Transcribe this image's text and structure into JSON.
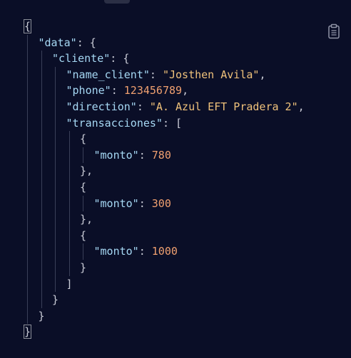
{
  "json_lines": [
    {
      "indent": 0,
      "parts": [
        {
          "t": "p",
          "v": "{"
        }
      ]
    },
    {
      "indent": 1,
      "parts": [
        {
          "t": "k",
          "v": "\"data\""
        },
        {
          "t": "p",
          "v": ": {"
        }
      ]
    },
    {
      "indent": 2,
      "parts": [
        {
          "t": "k",
          "v": "\"cliente\""
        },
        {
          "t": "p",
          "v": ": {"
        }
      ]
    },
    {
      "indent": 3,
      "parts": [
        {
          "t": "k",
          "v": "\"name_client\""
        },
        {
          "t": "p",
          "v": ": "
        },
        {
          "t": "s",
          "v": "\"Josthen Avila\""
        },
        {
          "t": "p",
          "v": ","
        }
      ]
    },
    {
      "indent": 3,
      "parts": [
        {
          "t": "k",
          "v": "\"phone\""
        },
        {
          "t": "p",
          "v": ": "
        },
        {
          "t": "n",
          "v": "123456789"
        },
        {
          "t": "p",
          "v": ","
        }
      ]
    },
    {
      "indent": 3,
      "parts": [
        {
          "t": "k",
          "v": "\"direction\""
        },
        {
          "t": "p",
          "v": ": "
        },
        {
          "t": "s",
          "v": "\"A. Azul EFT Pradera 2\""
        },
        {
          "t": "p",
          "v": ","
        }
      ]
    },
    {
      "indent": 3,
      "parts": [
        {
          "t": "k",
          "v": "\"transacciones\""
        },
        {
          "t": "p",
          "v": ": ["
        }
      ]
    },
    {
      "indent": 4,
      "parts": [
        {
          "t": "p",
          "v": "{"
        }
      ]
    },
    {
      "indent": 5,
      "parts": [
        {
          "t": "k",
          "v": "\"monto\""
        },
        {
          "t": "p",
          "v": ": "
        },
        {
          "t": "n",
          "v": "780"
        }
      ]
    },
    {
      "indent": 4,
      "parts": [
        {
          "t": "p",
          "v": "},"
        }
      ]
    },
    {
      "indent": 4,
      "parts": [
        {
          "t": "p",
          "v": "{"
        }
      ]
    },
    {
      "indent": 5,
      "parts": [
        {
          "t": "k",
          "v": "\"monto\""
        },
        {
          "t": "p",
          "v": ": "
        },
        {
          "t": "n",
          "v": "300"
        }
      ]
    },
    {
      "indent": 4,
      "parts": [
        {
          "t": "p",
          "v": "},"
        }
      ]
    },
    {
      "indent": 4,
      "parts": [
        {
          "t": "p",
          "v": "{"
        }
      ]
    },
    {
      "indent": 5,
      "parts": [
        {
          "t": "k",
          "v": "\"monto\""
        },
        {
          "t": "p",
          "v": ": "
        },
        {
          "t": "n",
          "v": "1000"
        }
      ]
    },
    {
      "indent": 4,
      "parts": [
        {
          "t": "p",
          "v": "}"
        }
      ]
    },
    {
      "indent": 3,
      "parts": [
        {
          "t": "p",
          "v": "]"
        }
      ]
    },
    {
      "indent": 2,
      "parts": [
        {
          "t": "p",
          "v": "}"
        }
      ]
    },
    {
      "indent": 1,
      "parts": [
        {
          "t": "p",
          "v": "}"
        }
      ]
    },
    {
      "indent": 0,
      "parts": [
        {
          "t": "p",
          "v": "}"
        }
      ]
    }
  ],
  "toolbar": {
    "copy_icon": "clipboard-icon"
  },
  "colors": {
    "background": "#0a0e27",
    "punctuation": "#c9cbd6",
    "key": "#a6d8f4",
    "string": "#f0c27b",
    "number": "#f0a070",
    "guide": "#3a3f58"
  }
}
